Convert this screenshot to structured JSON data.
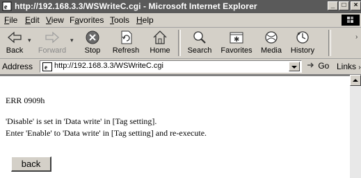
{
  "window": {
    "title": "http://192.168.3.3/WSWriteC.cgi - Microsoft Internet Explorer"
  },
  "menu": [
    {
      "pre": "",
      "key": "F",
      "post": "ile"
    },
    {
      "pre": "",
      "key": "E",
      "post": "dit"
    },
    {
      "pre": "",
      "key": "V",
      "post": "iew"
    },
    {
      "pre": "F",
      "key": "a",
      "post": "vorites"
    },
    {
      "pre": "",
      "key": "T",
      "post": "ools"
    },
    {
      "pre": "",
      "key": "H",
      "post": "elp"
    }
  ],
  "toolbar": {
    "back": "Back",
    "forward": "Forward",
    "stop": "Stop",
    "refresh": "Refresh",
    "home": "Home",
    "search": "Search",
    "favorites": "Favorites",
    "media": "Media",
    "history": "History"
  },
  "address": {
    "label": "Address",
    "url": "http://192.168.3.3/WSWriteC.cgi",
    "go": "Go",
    "links": "Links"
  },
  "content": {
    "error_code": "ERR 0909h",
    "line1": "'Disable' is set in 'Data write' in [Tag setting].",
    "line2": "Enter 'Enable' to 'Data write' in [Tag setting] and re-execute.",
    "back_button": "back"
  }
}
